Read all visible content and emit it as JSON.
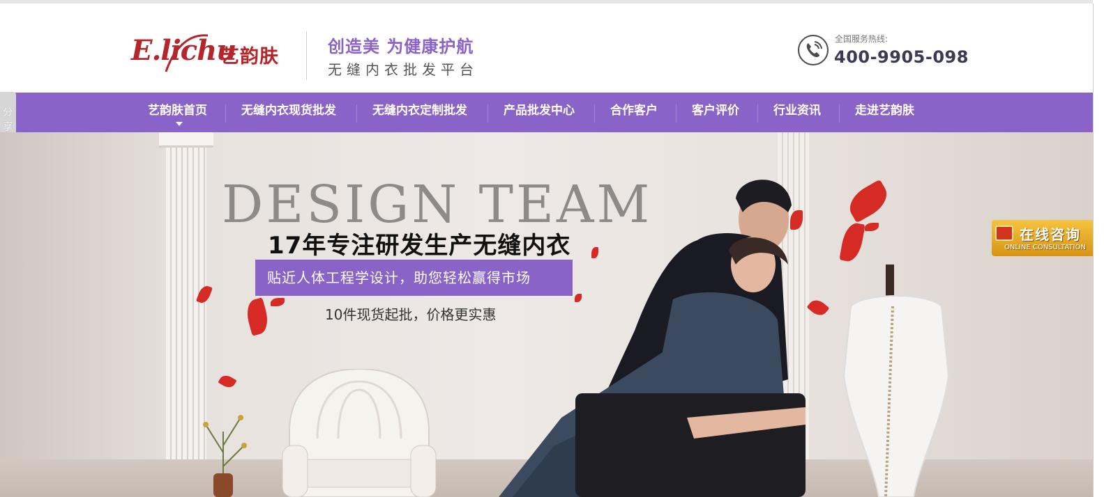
{
  "brand": {
    "logo_script": "E.lichu",
    "logo_cn": "艺韵肤",
    "slogan_main": "创造美 为健康护航",
    "slogan_sub": "无缝内衣批发平台"
  },
  "hotline": {
    "label": "全国服务热线:",
    "number": "400-9905-098",
    "icon": "phone-icon"
  },
  "nav": {
    "items": [
      {
        "label": "艺韵肤首页",
        "active": true
      },
      {
        "label": "无缝内衣现货批发"
      },
      {
        "label": "无缝内衣定制批发"
      },
      {
        "label": "产品批发中心"
      },
      {
        "label": "合作客户"
      },
      {
        "label": "客户评价"
      },
      {
        "label": "行业资讯"
      },
      {
        "label": "走进艺韵肤"
      }
    ]
  },
  "share": {
    "label_line1": "分",
    "label_line2": "享"
  },
  "banner": {
    "en_title": "DESIGN TEAM",
    "title": "17年专注研发生产无缝内衣",
    "highlight": "贴近人体工程学设计，助您轻松赢得市场",
    "subtitle": "10件现货起批，价格更实惠"
  },
  "online_consult": {
    "label": "在线咨询",
    "sub_label": "ONLINE CONSULTATION"
  },
  "colors": {
    "brand_red": "#b5262b",
    "accent_purple": "#8a63c8",
    "consult_gold": "#e0a020"
  }
}
